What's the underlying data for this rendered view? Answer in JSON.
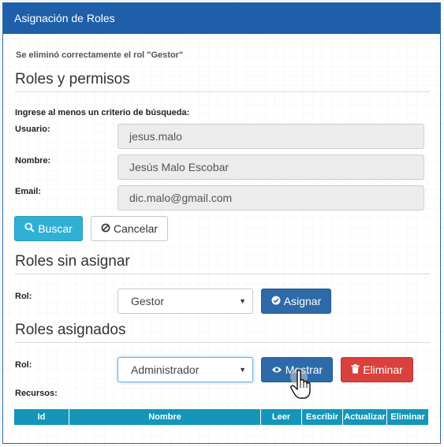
{
  "header": {
    "title": "Asignación de Roles"
  },
  "status_message": "Se eliminó correctamente el rol \"Gestor\"",
  "search": {
    "title": "Roles y permisos",
    "instruction": "Ingrese al menos un criterio de búsqueda:",
    "usuario_label": "Usuario:",
    "usuario_value": "jesus.malo",
    "nombre_label": "Nombre:",
    "nombre_value": "Jesús Malo Escobar",
    "email_label": "Email:",
    "email_value": "dic.malo@gmail.com",
    "buscar_label": "Buscar",
    "cancelar_label": "Cancelar"
  },
  "unassigned": {
    "title": "Roles sin asignar",
    "rol_label": "Rol:",
    "selected": "Gestor",
    "asignar_label": "Asignar"
  },
  "assigned": {
    "title": "Roles asignados",
    "rol_label": "Rol:",
    "selected": "Administrador",
    "mostrar_label": "Mostrar",
    "eliminar_label": "Eliminar",
    "recursos_label": "Recursos:"
  },
  "table": {
    "columns": [
      "Id",
      "Nombre",
      "Leer",
      "Escribir",
      "Actualizar",
      "Eliminar"
    ]
  },
  "colors": {
    "header_bg": "#1f5faa",
    "info": "#31b0d5",
    "primary": "#2e6aa8",
    "danger": "#d9413c",
    "table_head": "#1496b8"
  },
  "icons": {
    "buscar": "search-icon",
    "cancelar": "ban-icon",
    "asignar": "check-circle-icon",
    "mostrar": "eye-icon",
    "eliminar": "trash-icon"
  }
}
